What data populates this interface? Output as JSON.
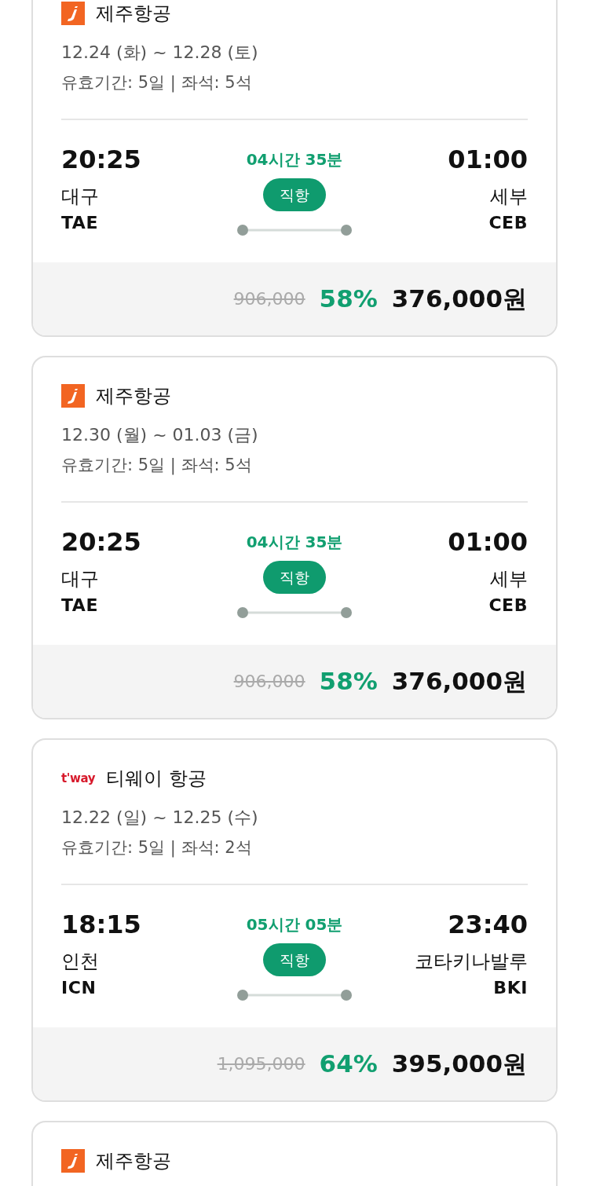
{
  "cards": [
    {
      "airline": {
        "kind": "jeju",
        "name": "제주항공"
      },
      "dates": "12.24 (화) ~ 12.28 (토)",
      "info": "유효기간: 5일 | 좌석: 5석",
      "departure": {
        "time": "20:25",
        "city": "대구",
        "code": "TAE"
      },
      "duration": "04시간 35분",
      "flight_type": "직항",
      "arrival": {
        "time": "01:00",
        "city": "세부",
        "code": "CEB"
      },
      "original_price": "906,000",
      "discount": "58%",
      "price": "376,000원"
    },
    {
      "airline": {
        "kind": "jeju",
        "name": "제주항공"
      },
      "dates": "12.30 (월) ~ 01.03 (금)",
      "info": "유효기간: 5일 | 좌석: 5석",
      "departure": {
        "time": "20:25",
        "city": "대구",
        "code": "TAE"
      },
      "duration": "04시간 35분",
      "flight_type": "직항",
      "arrival": {
        "time": "01:00",
        "city": "세부",
        "code": "CEB"
      },
      "original_price": "906,000",
      "discount": "58%",
      "price": "376,000원"
    },
    {
      "airline": {
        "kind": "tway",
        "logo_text": "t'way",
        "name": "티웨이 항공"
      },
      "dates": "12.22 (일) ~ 12.25 (수)",
      "info": "유효기간: 5일 | 좌석: 2석",
      "departure": {
        "time": "18:15",
        "city": "인천",
        "code": "ICN"
      },
      "duration": "05시간 05분",
      "flight_type": "직항",
      "arrival": {
        "time": "23:40",
        "city": "코타키나발루",
        "code": "BKI"
      },
      "original_price": "1,095,000",
      "discount": "64%",
      "price": "395,000원"
    },
    {
      "airline": {
        "kind": "jeju",
        "name": "제주항공"
      }
    }
  ]
}
